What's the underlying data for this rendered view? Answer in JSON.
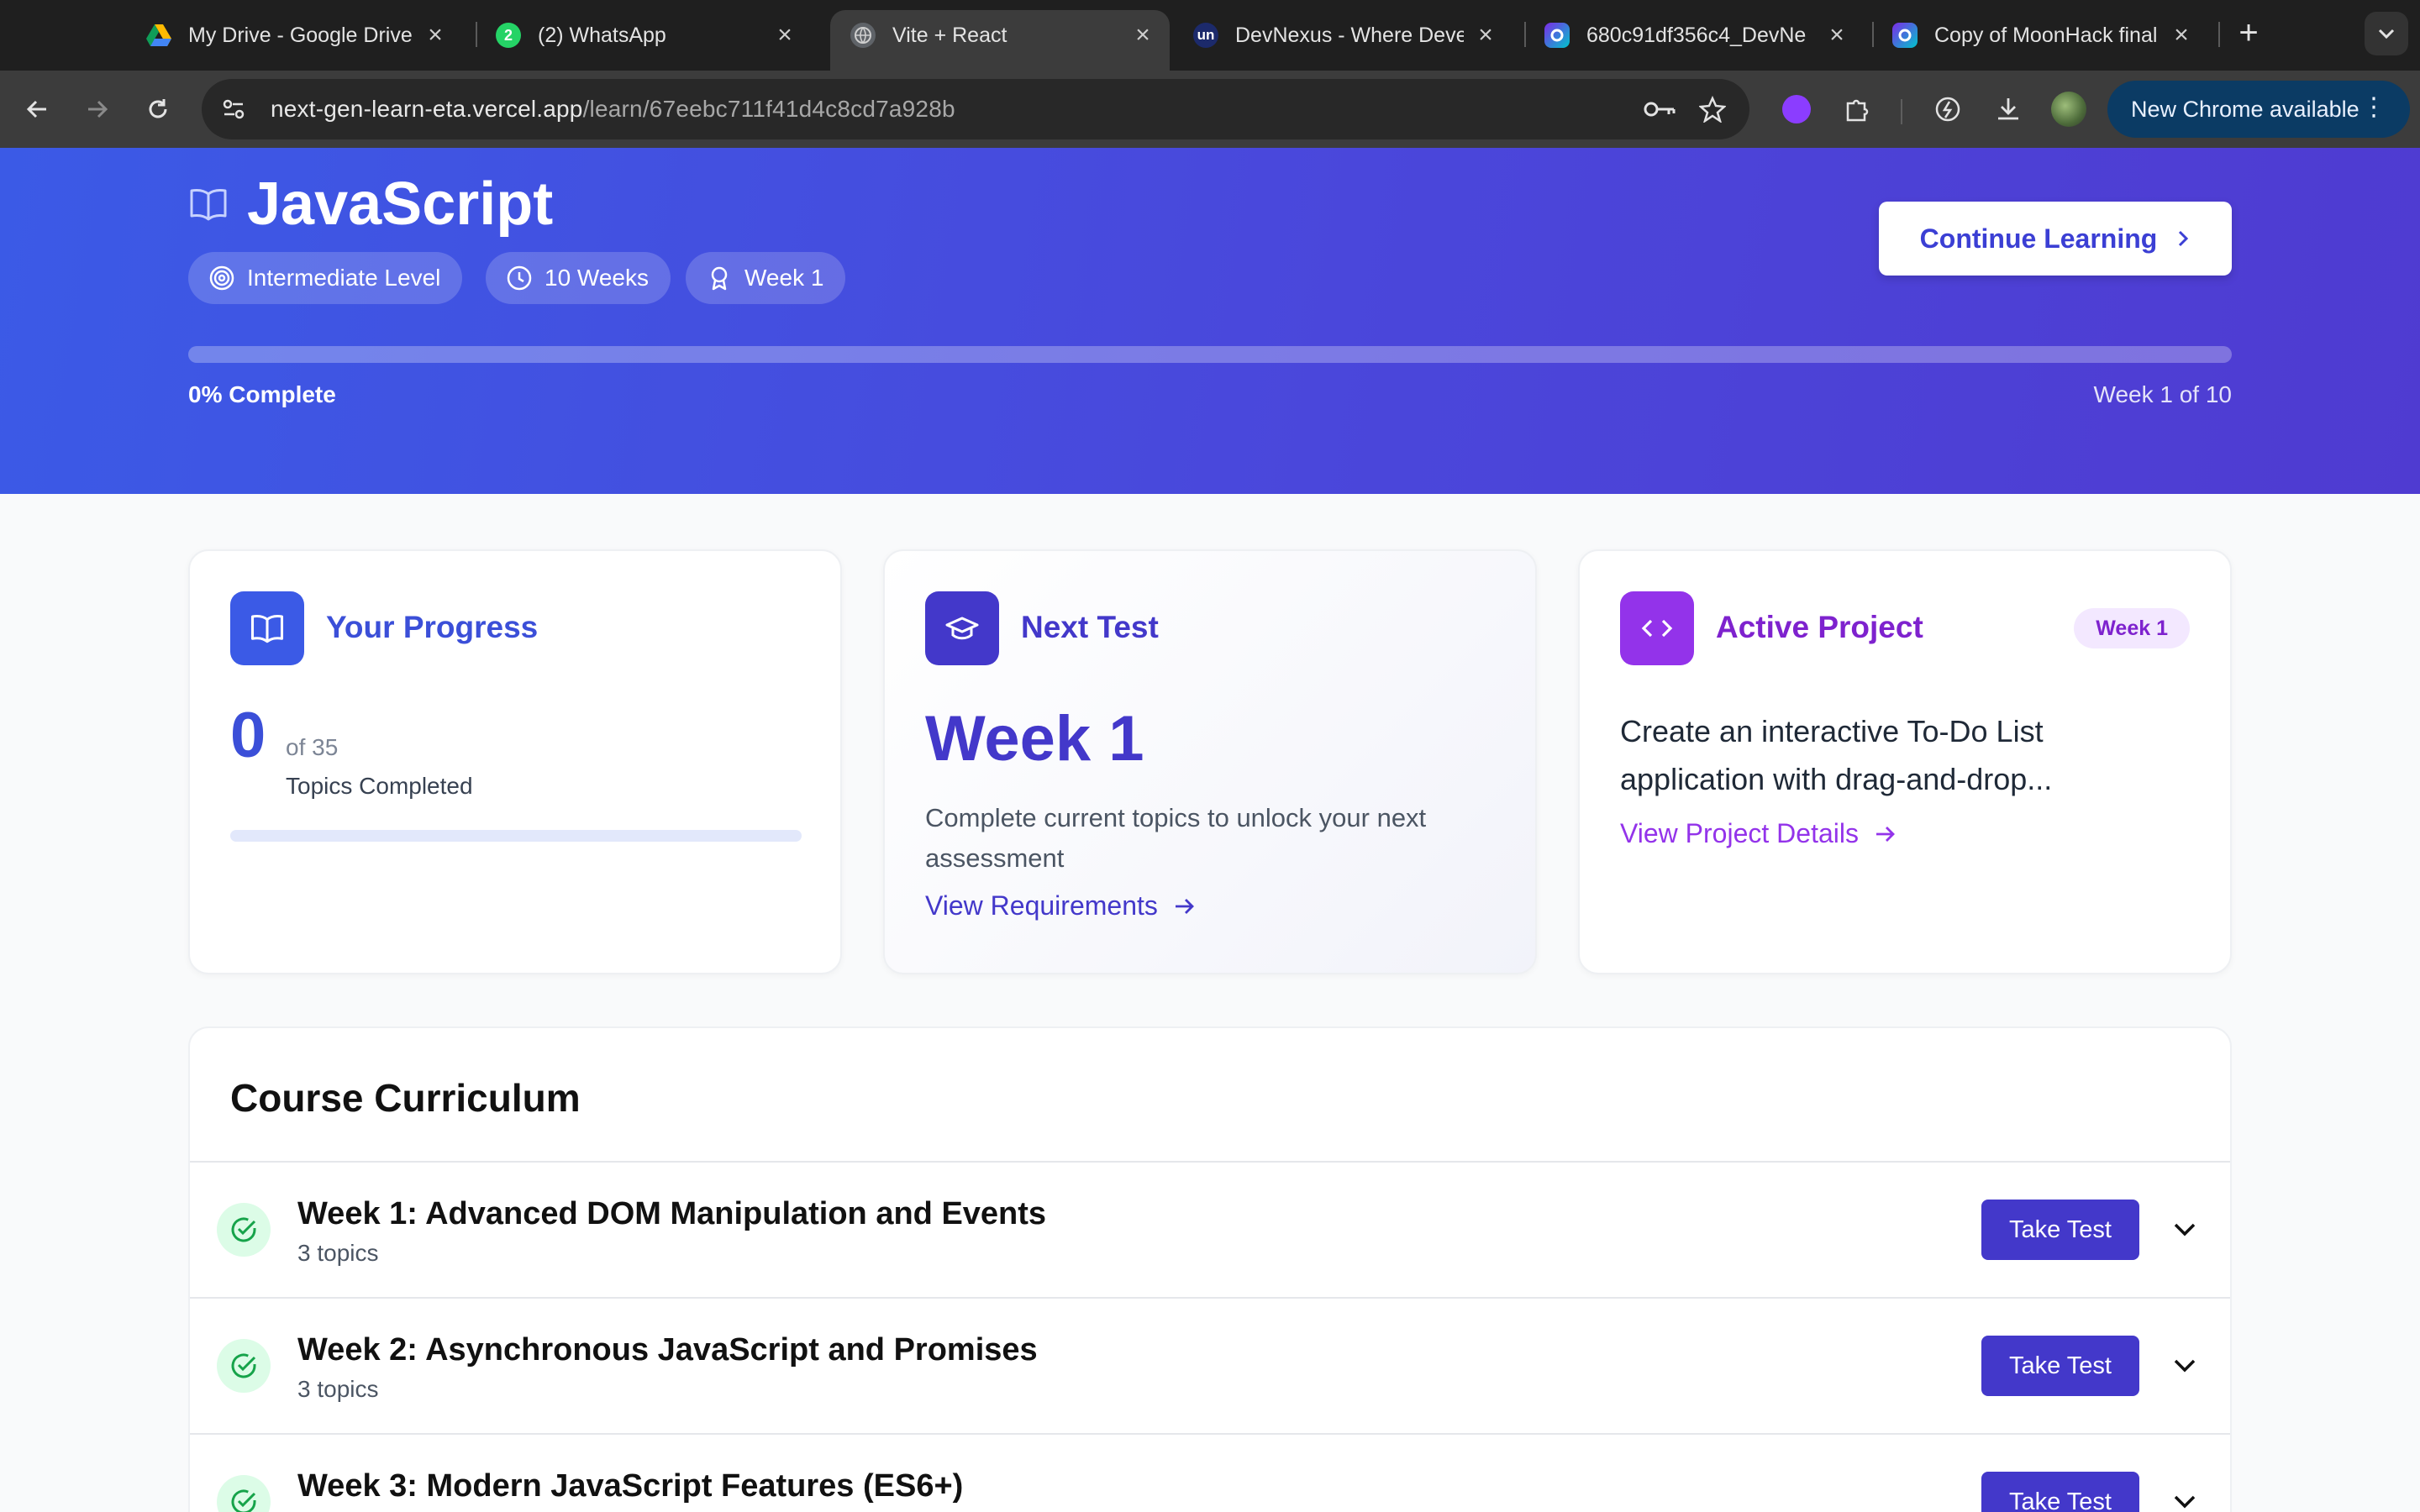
{
  "browser": {
    "tabs": [
      {
        "title": "My Drive - Google Drive",
        "icon": "google-drive-icon",
        "active": false
      },
      {
        "title": "(2) WhatsApp",
        "icon": "whatsapp-icon",
        "badge": "2",
        "active": false
      },
      {
        "title": "Vite + React",
        "icon": "globe-icon",
        "active": true
      },
      {
        "title": "DevNexus - Where Deve",
        "icon": "unstop-icon",
        "badge": "un",
        "active": false
      },
      {
        "title": "680c91df356c4_DevNe",
        "icon": "canva-icon",
        "active": false
      },
      {
        "title": "Copy of MoonHack final",
        "icon": "canva-icon",
        "active": false
      }
    ],
    "url_host": "next-gen-learn-eta.vercel.app",
    "url_path": "/learn/67eebc711f41d4c8cd7a928b",
    "update_label": "New Chrome available"
  },
  "hero": {
    "title": "JavaScript",
    "level": "Intermediate Level",
    "duration": "10 Weeks",
    "current_week": "Week 1",
    "continue_label": "Continue Learning",
    "progress_percent": 0,
    "progress_label": "0% Complete",
    "week_of": "Week 1 of 10"
  },
  "cards": {
    "progress": {
      "title": "Your Progress",
      "completed": "0",
      "of_total": "of 35",
      "label": "Topics Completed",
      "fraction": 0
    },
    "next_test": {
      "title": "Next Test",
      "week": "Week 1",
      "description": "Complete current topics to unlock your next assessment",
      "link": "View Requirements"
    },
    "project": {
      "title": "Active Project",
      "badge": "Week 1",
      "description": "Create an interactive To-Do List application with drag-and-drop...",
      "link": "View Project Details"
    }
  },
  "curriculum": {
    "heading": "Course Curriculum",
    "take_test_label": "Take Test",
    "weeks": [
      {
        "title": "Week 1: Advanced DOM Manipulation and Events",
        "topics": "3 topics"
      },
      {
        "title": "Week 2: Asynchronous JavaScript and Promises",
        "topics": "3 topics"
      },
      {
        "title": "Week 3: Modern JavaScript Features (ES6+)",
        "topics": ""
      }
    ]
  },
  "colors": {
    "hero_start": "#3b5ae6",
    "hero_end": "#4f3bd1",
    "accent_indigo": "#4338ca",
    "accent_purple": "#9333ea",
    "success_green": "#16a34a"
  }
}
